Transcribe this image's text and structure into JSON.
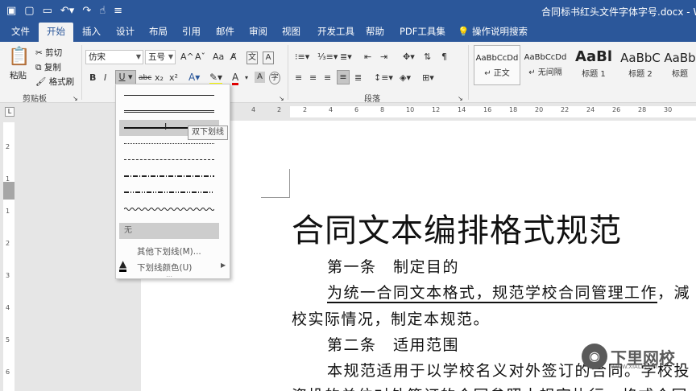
{
  "titlebar": {
    "qat_icons": [
      "save-icon",
      "new-doc-icon",
      "open-folder-icon",
      "undo-icon",
      "redo-icon",
      "touch-mode-icon",
      "customize-qat-icon"
    ],
    "document_title": "合同标书红头文件字体字号.docx",
    "app_name_fragment": "Wo"
  },
  "tabs": [
    "文件",
    "开始",
    "插入",
    "设计",
    "布局",
    "引用",
    "邮件",
    "审阅",
    "视图",
    "开发工具",
    "帮助",
    "PDF工具集"
  ],
  "active_tab": "开始",
  "tell_me": "操作说明搜索",
  "clipboard": {
    "paste": "粘贴",
    "cut": "剪切",
    "copy": "复制",
    "format_painter": "格式刷",
    "group_label": "剪贴板"
  },
  "font": {
    "font_name": "仿宋",
    "font_size": "五号",
    "grow_label": "A^",
    "shrink_label": "Aˇ",
    "case_label": "Aa",
    "bold": "B",
    "italic": "I",
    "underline": "U",
    "strike": "abc",
    "subscript": "x₂",
    "superscript": "x²"
  },
  "paragraph": {
    "group_label": "段落"
  },
  "styles": [
    {
      "sample": "AaBbCcDd",
      "name": "↵ 正文"
    },
    {
      "sample": "AaBbCcDd",
      "name": "↵ 无间隔"
    },
    {
      "sample": "AaBl",
      "name": "标题 1"
    },
    {
      "sample": "AaBbC",
      "name": "标题 2"
    },
    {
      "sample": "AaBb",
      "name": "标题"
    }
  ],
  "ruler": {
    "h_numbers": [
      "4",
      "2",
      "2",
      "4",
      "6",
      "8",
      "10",
      "12",
      "14",
      "16",
      "18",
      "20",
      "22",
      "24",
      "26",
      "28",
      "30"
    ],
    "v_numbers": [
      "2",
      "1",
      "1",
      "2",
      "3",
      "4",
      "5",
      "6"
    ]
  },
  "underline_menu": {
    "line_styles": [
      "single",
      "double",
      "thick",
      "dotted",
      "dashed",
      "dash-dot",
      "dash-dot-dot",
      "wavy"
    ],
    "hovered_index": 2,
    "none_label": "无",
    "more_label": "其他下划线(M)...",
    "color_label": "下划线颜色(U)",
    "tooltip": "双下划线"
  },
  "document": {
    "heading": "合同文本编排格式规范",
    "line1": "第一条　制定目的",
    "line2_underlined": "为统一合同文本格式，规范学校合同管理工作",
    "line2_rest": "，減",
    "line3": "校实际情况，制定本规范。",
    "line4": "第二条　适用范围",
    "line5": "本规范适用于以学校名义对外签订的合同。学校投",
    "line6": "资投的单位对外签订的合同参照本规定执行。格式合同"
  },
  "watermark": {
    "brand": "下里网校",
    "url": "WWW.XIALI.COM"
  },
  "colors": {
    "ribbon_blue": "#2b579a",
    "highlight_yellow": "#ffff00",
    "font_color_red": "#e00000"
  }
}
